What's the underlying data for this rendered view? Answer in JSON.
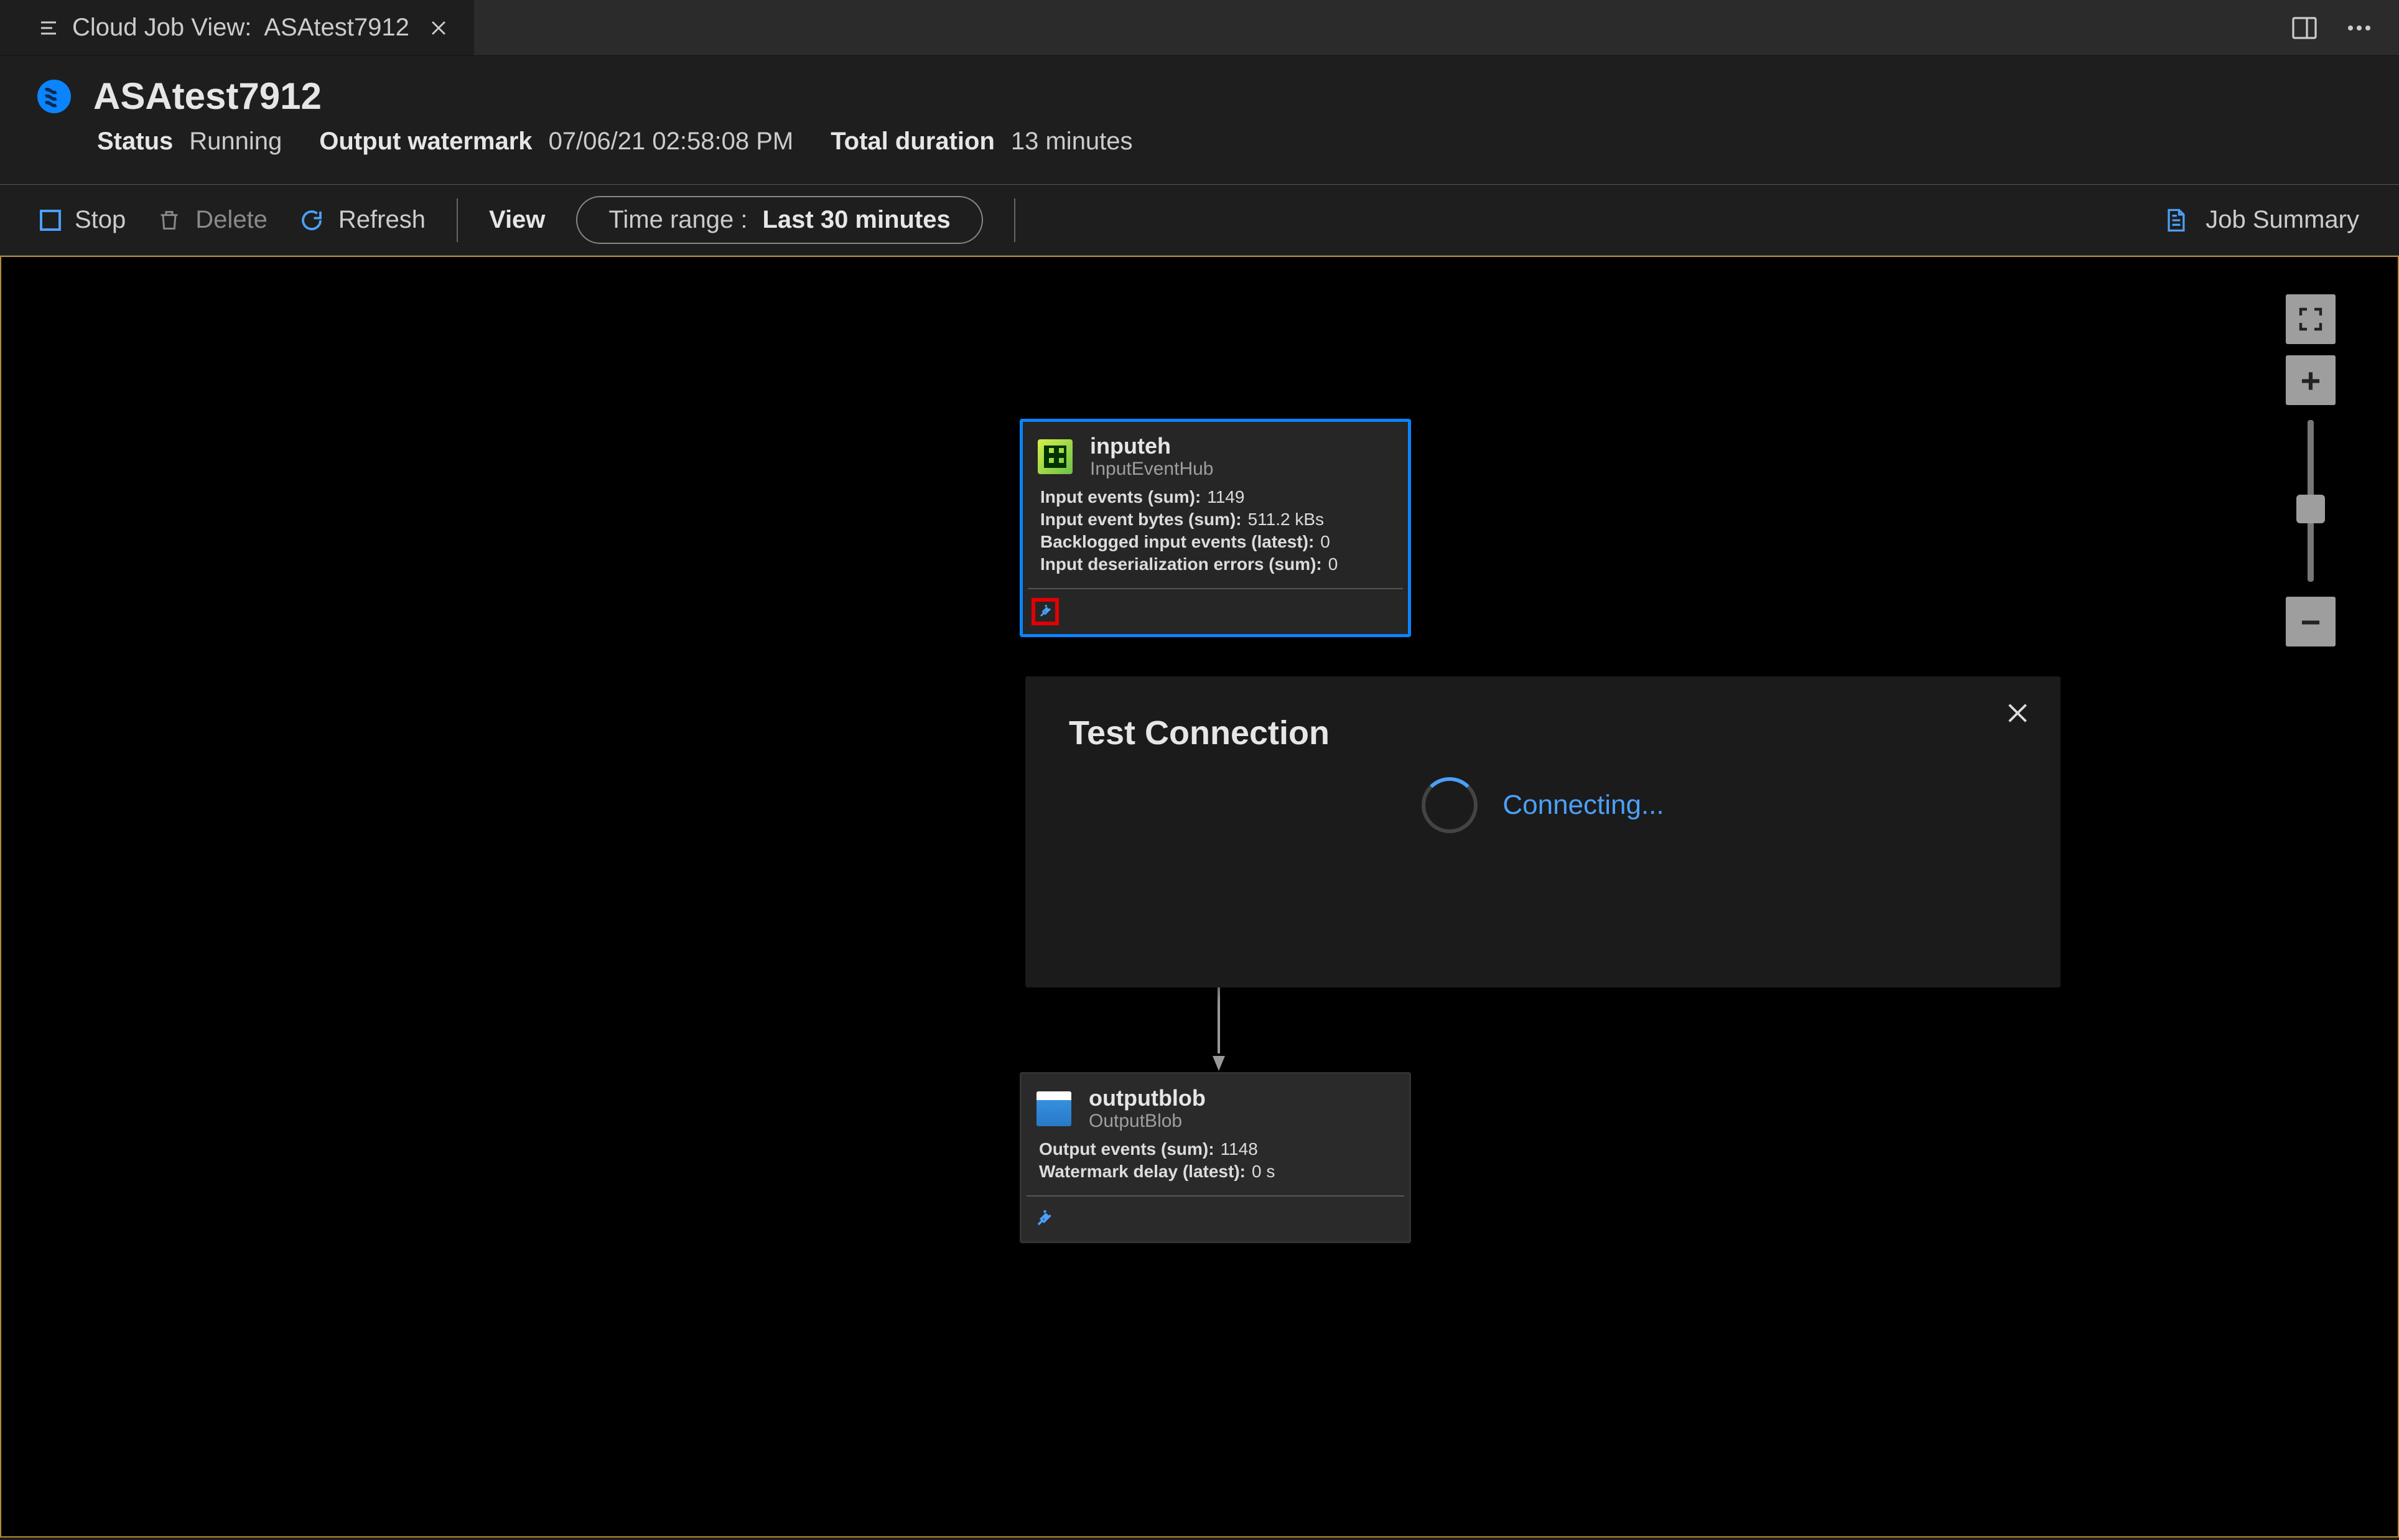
{
  "tab": {
    "prefix": "Cloud Job View:",
    "name": "ASAtest7912"
  },
  "header": {
    "jobName": "ASAtest7912",
    "statusLabel": "Status",
    "statusValue": "Running",
    "watermarkLabel": "Output watermark",
    "watermarkValue": "07/06/21 02:58:08 PM",
    "durationLabel": "Total duration",
    "durationValue": "13 minutes"
  },
  "toolbar": {
    "stop": "Stop",
    "delete": "Delete",
    "refresh": "Refresh",
    "view": "View",
    "timeRangeLabel": "Time range :",
    "timeRangeValue": "Last 30 minutes",
    "jobSummary": "Job Summary"
  },
  "dialog": {
    "title": "Test Connection",
    "status": "Connecting..."
  },
  "nodes": {
    "input": {
      "title": "inputeh",
      "subtitle": "InputEventHub",
      "metrics": [
        {
          "k": "Input events (sum):",
          "v": "1149"
        },
        {
          "k": "Input event bytes (sum):",
          "v": "511.2 kBs"
        },
        {
          "k": "Backlogged input events (latest):",
          "v": "0"
        },
        {
          "k": "Input deserialization errors (sum):",
          "v": "0"
        }
      ]
    },
    "output": {
      "title": "outputblob",
      "subtitle": "OutputBlob",
      "metrics": [
        {
          "k": "Output events (sum):",
          "v": "1148"
        },
        {
          "k": "Watermark delay (latest):",
          "v": "0 s"
        }
      ]
    }
  },
  "colors": {
    "accent": "#0a84ff",
    "link": "#4ba0f8",
    "danger": "#e20000"
  }
}
